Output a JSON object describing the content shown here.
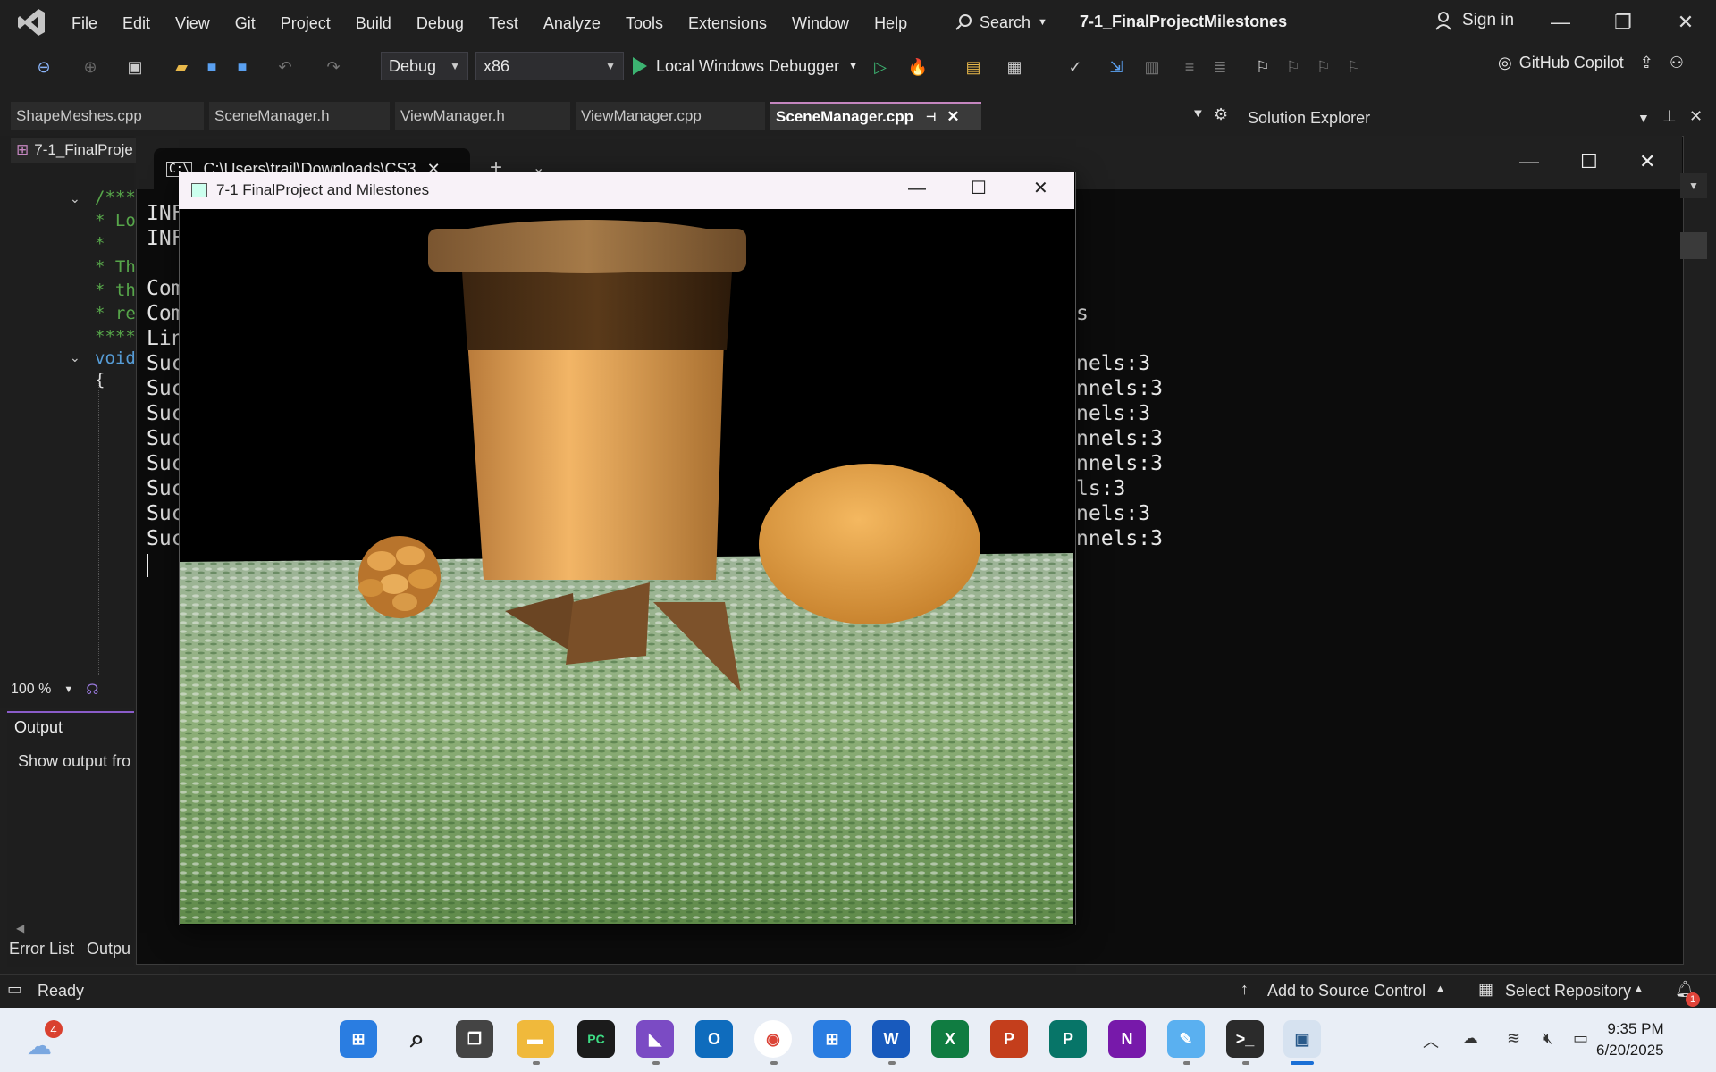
{
  "menu": [
    "File",
    "Edit",
    "View",
    "Git",
    "Project",
    "Build",
    "Debug",
    "Test",
    "Analyze",
    "Tools",
    "Extensions",
    "Window",
    "Help"
  ],
  "search_label": "Search",
  "project_title": "7-1_FinalProjectMilestones",
  "sign_in": "Sign in",
  "toolbar": {
    "config": "Debug",
    "platform": "x86",
    "run_label": "Local Windows Debugger",
    "copilot": "GitHub Copilot"
  },
  "tabs": [
    "ShapeMeshes.cpp",
    "SceneManager.h",
    "ViewManager.h",
    "ViewManager.cpp",
    "SceneManager.cpp"
  ],
  "editor": {
    "nav_label": "7-1_FinalProje",
    "code": [
      "/***",
      "* Lo",
      "*",
      "* Th",
      "* th",
      "* re",
      "****",
      "void",
      "{"
    ],
    "zoom": "100 %"
  },
  "solution_explorer": "Solution Explorer",
  "output_panel": {
    "title": "Output",
    "show_from": "Show output fro",
    "bottom_tabs": [
      "Error List",
      "Outpu"
    ]
  },
  "console": {
    "tab_title": "C:\\Users\\trail\\Downloads\\CS3",
    "left_lines": [
      "INF",
      "INF",
      "",
      "Com",
      "Com",
      "Lin",
      "Suc",
      "Suc",
      "Suc",
      "Suc",
      "Suc",
      "Suc",
      "Suc",
      "Suc"
    ],
    "right_lines": [
      "s",
      "",
      "nels:3",
      "nnels:3",
      "nels:3",
      "nnels:3",
      "nnels:3",
      "ls:3",
      "nels:3",
      "nnels:3"
    ]
  },
  "gl_window": {
    "title": "7-1 FinalProject and Milestones"
  },
  "status": {
    "ready": "Ready",
    "source_control": "Add to Source Control",
    "repo": "Select Repository"
  },
  "taskbar": {
    "weather_badge": "4",
    "time": "9:35 PM",
    "date": "6/20/2025",
    "notif_badge": "1"
  }
}
